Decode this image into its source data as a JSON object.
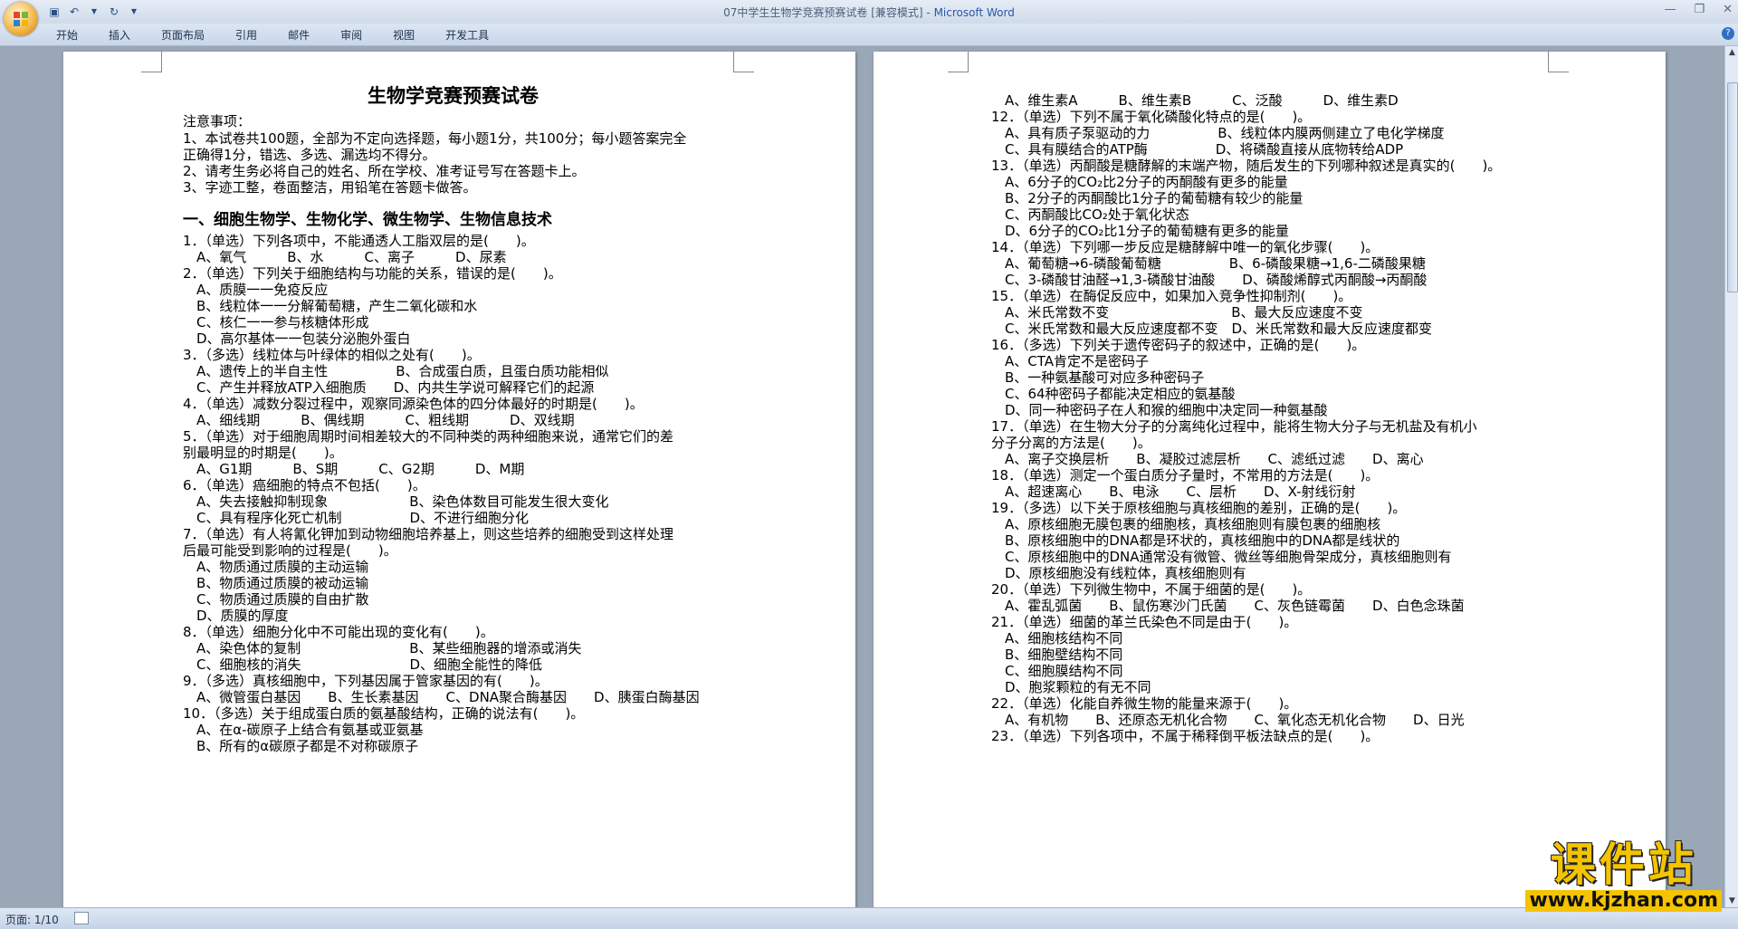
{
  "window": {
    "title_doc": "07中学生生物学竞赛预赛试卷 [兼容模式] - ",
    "title_app": "Microsoft Word"
  },
  "ribbon": {
    "tabs": [
      "开始",
      "插入",
      "页面布局",
      "引用",
      "邮件",
      "审阅",
      "视图",
      "开发工具"
    ]
  },
  "status": {
    "page": "页面: 1/10"
  },
  "watermark": {
    "text": "课件站",
    "url": "www.kjzhan.com"
  },
  "page1": {
    "lines": [
      "生物学竞赛预赛试卷",
      "注意事项：",
      "1、本试卷共100题，全部为不定向选择题，每小题1分，共100分；每小题答案完全",
      "正确得1分，错选、多选、漏选均不得分。",
      "2、请考生务必将自己的姓名、所在学校、准考证号写在答题卡上。",
      "3、字迹工整，卷面整洁，用铅笔在答题卡做答。",
      "一、细胞生物学、生物化学、微生物学、生物信息技术",
      "1．（单选）下列各项中，不能通透人工脂双层的是(　　)。",
      "A、氧气　　　B、水　　　C、离子　　　D、尿素",
      "2．（单选）下列关于细胞结构与功能的关系，错误的是(　　)。",
      "A、质膜一一免疫反应",
      "B、线粒体一一分解葡萄糖，产生二氧化碳和水",
      "C、核仁一一参与核糖体形成",
      "D、高尔基体一一包装分泌胞外蛋白",
      "3．（多选）线粒体与叶绿体的相似之处有(　　)。",
      "A、遗传上的半自主性　　　　　B、合成蛋白质，且蛋白质功能相似",
      "C、产生并释放ATP入细胞质　　D、内共生学说可解释它们的起源",
      "4．（单选）减数分裂过程中，观察同源染色体的四分体最好的时期是(　　)。",
      "A、细线期　　　B、偶线期　　　C、粗线期　　　D、双线期",
      "5．（单选）对于细胞周期时间相差较大的不同种类的两种细胞来说，通常它们的差",
      "别最明显的时期是(　　)。",
      "A、G1期　　　B、S期　　　C、G2期　　　D、M期",
      "6．（单选）癌细胞的特点不包括(　　)。",
      "A、失去接触抑制现象　　　　　　B、染色体数目可能发生很大变化",
      "C、具有程序化死亡机制　　　　　D、不进行细胞分化",
      "7．（单选）有人将氰化钾加到动物细胞培养基上，则这些培养的细胞受到这样处理",
      "后最可能受到影响的过程是(　　)。",
      "A、物质通过质膜的主动运输",
      "B、物质通过质膜的被动运输",
      "C、物质通过质膜的自由扩散",
      "D、质膜的厚度",
      "8．（单选）细胞分化中不可能出现的变化有(　　)。",
      "A、染色体的复制　　　　　　　　B、某些细胞器的增添或消失",
      "C、细胞核的消失　　　　　　　　D、细胞全能性的降低",
      "9．（多选）真核细胞中，下列基因属于管家基因的有(　　)。",
      "A、微管蛋白基因　　B、生长素基因　　C、DNA聚合酶基因　　D、胰蛋白酶基因",
      "10．（多选）关于组成蛋白质的氨基酸结构，正确的说法有(　　)。",
      "A、在α-碳原子上结合有氨基或亚氨基",
      "B、所有的α碳原子都是不对称碳原子"
    ]
  },
  "page2": {
    "lines": [
      "A、维生素A　　　B、维生素B　　　C、泛酸　　　D、维生素D",
      "12．（单选）下列不属于氧化磷酸化特点的是(　　)。",
      "A、具有质子泵驱动的力　　　　　B、线粒体内膜两侧建立了电化学梯度",
      "C、具有膜结合的ATP酶　　　　　D、将磷酸直接从底物转给ADP",
      "13．（单选）丙酮酸是糖酵解的末端产物，随后发生的下列哪种叙述是真实的(　　)。",
      "A、6分子的CO₂比2分子的丙酮酸有更多的能量",
      "B、2分子的丙酮酸比1分子的葡萄糖有较少的能量",
      "C、丙酮酸比CO₂处于氧化状态",
      "D、6分子的CO₂比1分子的葡萄糖有更多的能量",
      "14．（单选）下列哪一步反应是糖酵解中唯一的氧化步骤(　　)。",
      "A、葡萄糖→6-磷酸葡萄糖　　　　　B、6-磷酸果糖→1,6-二磷酸果糖",
      "C、3-磷酸甘油醛→1,3-磷酸甘油酸　　D、磷酸烯醇式丙酮酸→丙酮酸",
      "15．（单选）在酶促反应中，如果加入竞争性抑制剂(　　)。",
      "A、米氏常数不变　　　　　　　　　B、最大反应速度不变",
      "C、米氏常数和最大反应速度都不变　D、米氏常数和最大反应速度都变",
      "16．（多选）下列关于遗传密码子的叙述中，正确的是(　　)。",
      "A、CTA肯定不是密码子",
      "B、一种氨基酸可对应多种密码子",
      "C、64种密码子都能决定相应的氨基酸",
      "D、同一种密码子在人和猴的细胞中决定同一种氨基酸",
      "17．（单选）在生物大分子的分离纯化过程中，能将生物大分子与无机盐及有机小",
      "分子分离的方法是(　　)。",
      "A、离子交换层析　　B、凝胶过滤层析　　C、滤纸过滤　　D、离心",
      "18．（单选）测定一个蛋白质分子量时，不常用的方法是(　　)。",
      "A、超速离心　　B、电泳　　C、层析　　D、X-射线衍射",
      "19．（多选）以下关于原核细胞与真核细胞的差别，正确的是(　　)。",
      "A、原核细胞无膜包裹的细胞核，真核细胞则有膜包裹的细胞核",
      "B、原核细胞中的DNA都是环状的，真核细胞中的DNA都是线状的",
      "C、原核细胞中的DNA通常没有微管、微丝等细胞骨架成分，真核细胞则有",
      "D、原核细胞没有线粒体，真核细胞则有",
      "20．（单选）下列微生物中，不属于细菌的是(　　)。",
      "A、霍乱弧菌　　B、鼠伤寒沙门氏菌　　C、灰色链霉菌　　D、白色念珠菌",
      "21．（单选）细菌的革兰氏染色不同是由于(　　)。",
      "A、细胞核结构不同",
      "B、细胞壁结构不同",
      "C、细胞膜结构不同",
      "D、胞浆颗粒的有无不同",
      "22．（单选）化能自养微生物的能量来源于(　　)。",
      "A、有机物　　B、还原态无机化合物　　C、氧化态无机化合物　　D、日光",
      "23．（单选）下列各项中，不属于稀释倒平板法缺点的是(　　)。"
    ]
  }
}
